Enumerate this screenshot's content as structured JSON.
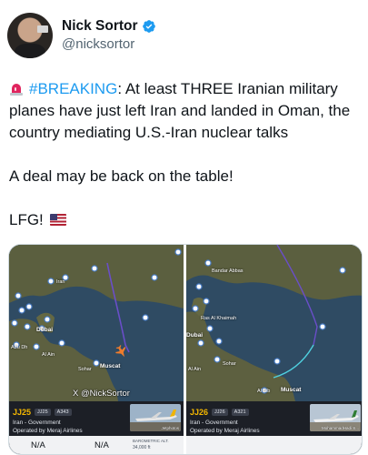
{
  "author": {
    "display_name": "Nick Sortor",
    "handle": "@nicksortor",
    "verified": true,
    "avatar_icon": "profile-photo"
  },
  "tweet": {
    "line1_hashtag": "#BREAKING",
    "line1_rest": ": At least THREE Iranian military planes have just left Iran and landed in Oman, the country mediating U.S.-Iran nuclear talks",
    "line2": "A deal may be back on the table!",
    "line3": "LFG!",
    "emoji_siren": "siren-icon",
    "emoji_flag": "us-flag-icon"
  },
  "colors": {
    "hashtag": "#1d9bf0",
    "callsign": "#f5b800",
    "water": "#2f4b63",
    "land": "#58603f",
    "track_purple": "#6a4ec9",
    "track_cyan": "#4fd1e0",
    "plane_orange": "#f07c2c"
  },
  "media": {
    "left": {
      "map_labels": [
        "Iran",
        "Dubai",
        "Al Ain",
        "Muscat",
        "Abu Dh",
        "Sohar"
      ],
      "watermark": "X @NickSortor",
      "callsign": "JJ25",
      "badge1": "JJ25",
      "badge2": "A343",
      "operator_line": "Iran - Government",
      "airline_line": "Operated by Meraj Airlines",
      "photo_credit": "Jetphotos",
      "stat1_value": "N/A",
      "stat2_value": "N/A",
      "stat3_label": "BAROMETRIC ALT.",
      "stat3_value": "34,000 ft"
    },
    "right": {
      "map_labels": [
        "Bandar Abbas",
        "Ras Al Khaimah",
        "Dubai",
        "Sohar",
        "Al Ain",
        "Muscat",
        "Al Sib"
      ],
      "callsign": "JJ26",
      "badge1": "JJ26",
      "badge2": "A321",
      "operator_line": "Iran - Government",
      "airline_line": "Operated by Meraj Airlines",
      "photo_credit": "MohammadHadi S..."
    }
  }
}
